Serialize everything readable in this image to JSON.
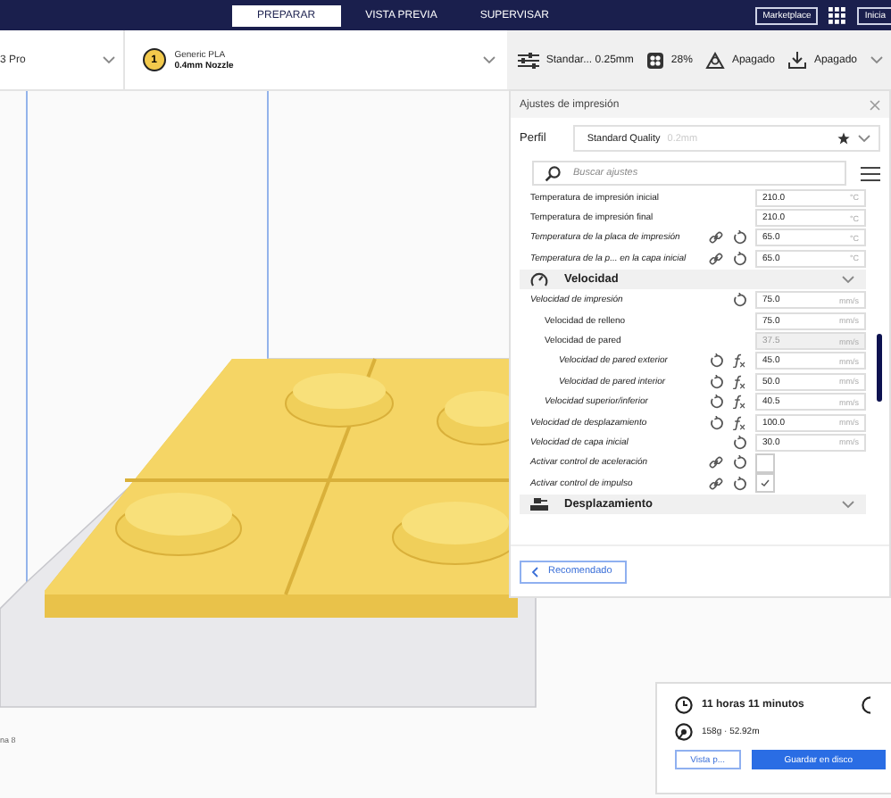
{
  "topbar": {
    "tabs": [
      {
        "label": "PREPARAR",
        "selected": true
      },
      {
        "label": "VISTA PREVIA",
        "selected": false
      },
      {
        "label": "SUPERVISAR",
        "selected": false
      }
    ],
    "marketplace": "Marketplace",
    "signin": "Inicia"
  },
  "toolbar": {
    "printer": "3 Pro",
    "extruder": {
      "number": "1",
      "material": "Generic PLA",
      "nozzle": "0.4mm Nozzle"
    },
    "profile": "Standar... 0.25mm",
    "infill": "28%",
    "support": "Apagado",
    "adhesion": "Apagado"
  },
  "viewport": {
    "status": "na 8"
  },
  "settings_panel": {
    "title": "Ajustes de impresión",
    "profile_label": "Perfil",
    "profile": "Standard Quality",
    "profile_layer": "0.2mm",
    "search": {
      "placeholder": "Buscar ajustes"
    },
    "items": [
      {
        "kind": "number",
        "label": "Temperatura de impresión inicial",
        "modified": false,
        "link": false,
        "reset": false,
        "formula": false,
        "value": "210.0",
        "unit": "°C",
        "disabled": false
      },
      {
        "kind": "number",
        "label": "Temperatura de impresión final",
        "modified": false,
        "link": false,
        "reset": false,
        "formula": false,
        "value": "210.0",
        "unit": "°C",
        "disabled": false
      },
      {
        "kind": "number",
        "label": "Temperatura de la placa de impresión",
        "modified": true,
        "link": true,
        "reset": true,
        "formula": false,
        "value": "65.0",
        "unit": "°C",
        "disabled": false
      },
      {
        "kind": "number",
        "label": "Temperatura de la p... en la capa inicial",
        "modified": true,
        "link": true,
        "reset": true,
        "formula": false,
        "value": "65.0",
        "unit": "°C",
        "disabled": false
      },
      {
        "kind": "section",
        "title": "Velocidad"
      },
      {
        "kind": "number",
        "label": "Velocidad de impresión",
        "modified": true,
        "link": false,
        "reset": true,
        "formula": false,
        "value": "75.0",
        "unit": "mm/s",
        "disabled": false,
        "children": [
          {
            "kind": "number",
            "label": "Velocidad de relleno",
            "modified": false,
            "link": false,
            "reset": false,
            "formula": false,
            "value": "75.0",
            "unit": "mm/s",
            "disabled": false
          },
          {
            "kind": "number",
            "label": "Velocidad de pared",
            "modified": false,
            "link": false,
            "reset": false,
            "formula": false,
            "value": "37.5",
            "unit": "mm/s",
            "disabled": true,
            "children": [
              {
                "kind": "number",
                "label": "Velocidad de pared exterior",
                "modified": true,
                "link": false,
                "reset": true,
                "formula": true,
                "value": "45.0",
                "unit": "mm/s",
                "disabled": false
              },
              {
                "kind": "number",
                "label": "Velocidad de pared interior",
                "modified": true,
                "link": false,
                "reset": true,
                "formula": true,
                "value": "50.0",
                "unit": "mm/s",
                "disabled": false
              }
            ]
          },
          {
            "kind": "number",
            "label": "Velocidad superior/inferior",
            "modified": true,
            "link": false,
            "reset": true,
            "formula": true,
            "value": "40.5",
            "unit": "mm/s",
            "disabled": false
          }
        ]
      },
      {
        "kind": "number",
        "label": "Velocidad de desplazamiento",
        "modified": true,
        "link": false,
        "reset": true,
        "formula": true,
        "value": "100.0",
        "unit": "mm/s",
        "disabled": false
      },
      {
        "kind": "number",
        "label": "Velocidad de capa inicial",
        "modified": true,
        "link": false,
        "reset": true,
        "formula": false,
        "value": "30.0",
        "unit": "mm/s",
        "disabled": false
      },
      {
        "kind": "checkbox",
        "label": "Activar control de aceleración",
        "modified": true,
        "link": true,
        "reset": true,
        "checked": false
      },
      {
        "kind": "checkbox",
        "label": "Activar control de impulso",
        "modified": true,
        "link": true,
        "reset": true,
        "checked": true
      },
      {
        "kind": "section",
        "title": "Desplazamiento"
      }
    ],
    "back_button": "Recomendado"
  },
  "print_summary": {
    "time": "11 horas 11 minutos",
    "material": "158g · 52.92m",
    "preview_button": "Vista p...",
    "save_button": "Guardar en disco"
  }
}
